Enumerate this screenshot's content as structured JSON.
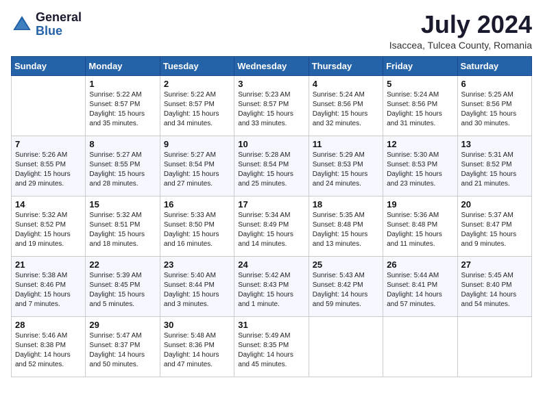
{
  "header": {
    "logo_general": "General",
    "logo_blue": "Blue",
    "month_title": "July 2024",
    "location": "Isaccea, Tulcea County, Romania"
  },
  "calendar": {
    "days_of_week": [
      "Sunday",
      "Monday",
      "Tuesday",
      "Wednesday",
      "Thursday",
      "Friday",
      "Saturday"
    ],
    "weeks": [
      [
        {
          "day": "",
          "info": ""
        },
        {
          "day": "1",
          "info": "Sunrise: 5:22 AM\nSunset: 8:57 PM\nDaylight: 15 hours\nand 35 minutes."
        },
        {
          "day": "2",
          "info": "Sunrise: 5:22 AM\nSunset: 8:57 PM\nDaylight: 15 hours\nand 34 minutes."
        },
        {
          "day": "3",
          "info": "Sunrise: 5:23 AM\nSunset: 8:57 PM\nDaylight: 15 hours\nand 33 minutes."
        },
        {
          "day": "4",
          "info": "Sunrise: 5:24 AM\nSunset: 8:56 PM\nDaylight: 15 hours\nand 32 minutes."
        },
        {
          "day": "5",
          "info": "Sunrise: 5:24 AM\nSunset: 8:56 PM\nDaylight: 15 hours\nand 31 minutes."
        },
        {
          "day": "6",
          "info": "Sunrise: 5:25 AM\nSunset: 8:56 PM\nDaylight: 15 hours\nand 30 minutes."
        }
      ],
      [
        {
          "day": "7",
          "info": "Sunrise: 5:26 AM\nSunset: 8:55 PM\nDaylight: 15 hours\nand 29 minutes."
        },
        {
          "day": "8",
          "info": "Sunrise: 5:27 AM\nSunset: 8:55 PM\nDaylight: 15 hours\nand 28 minutes."
        },
        {
          "day": "9",
          "info": "Sunrise: 5:27 AM\nSunset: 8:54 PM\nDaylight: 15 hours\nand 27 minutes."
        },
        {
          "day": "10",
          "info": "Sunrise: 5:28 AM\nSunset: 8:54 PM\nDaylight: 15 hours\nand 25 minutes."
        },
        {
          "day": "11",
          "info": "Sunrise: 5:29 AM\nSunset: 8:53 PM\nDaylight: 15 hours\nand 24 minutes."
        },
        {
          "day": "12",
          "info": "Sunrise: 5:30 AM\nSunset: 8:53 PM\nDaylight: 15 hours\nand 23 minutes."
        },
        {
          "day": "13",
          "info": "Sunrise: 5:31 AM\nSunset: 8:52 PM\nDaylight: 15 hours\nand 21 minutes."
        }
      ],
      [
        {
          "day": "14",
          "info": "Sunrise: 5:32 AM\nSunset: 8:52 PM\nDaylight: 15 hours\nand 19 minutes."
        },
        {
          "day": "15",
          "info": "Sunrise: 5:32 AM\nSunset: 8:51 PM\nDaylight: 15 hours\nand 18 minutes."
        },
        {
          "day": "16",
          "info": "Sunrise: 5:33 AM\nSunset: 8:50 PM\nDaylight: 15 hours\nand 16 minutes."
        },
        {
          "day": "17",
          "info": "Sunrise: 5:34 AM\nSunset: 8:49 PM\nDaylight: 15 hours\nand 14 minutes."
        },
        {
          "day": "18",
          "info": "Sunrise: 5:35 AM\nSunset: 8:48 PM\nDaylight: 15 hours\nand 13 minutes."
        },
        {
          "day": "19",
          "info": "Sunrise: 5:36 AM\nSunset: 8:48 PM\nDaylight: 15 hours\nand 11 minutes."
        },
        {
          "day": "20",
          "info": "Sunrise: 5:37 AM\nSunset: 8:47 PM\nDaylight: 15 hours\nand 9 minutes."
        }
      ],
      [
        {
          "day": "21",
          "info": "Sunrise: 5:38 AM\nSunset: 8:46 PM\nDaylight: 15 hours\nand 7 minutes."
        },
        {
          "day": "22",
          "info": "Sunrise: 5:39 AM\nSunset: 8:45 PM\nDaylight: 15 hours\nand 5 minutes."
        },
        {
          "day": "23",
          "info": "Sunrise: 5:40 AM\nSunset: 8:44 PM\nDaylight: 15 hours\nand 3 minutes."
        },
        {
          "day": "24",
          "info": "Sunrise: 5:42 AM\nSunset: 8:43 PM\nDaylight: 15 hours\nand 1 minute."
        },
        {
          "day": "25",
          "info": "Sunrise: 5:43 AM\nSunset: 8:42 PM\nDaylight: 14 hours\nand 59 minutes."
        },
        {
          "day": "26",
          "info": "Sunrise: 5:44 AM\nSunset: 8:41 PM\nDaylight: 14 hours\nand 57 minutes."
        },
        {
          "day": "27",
          "info": "Sunrise: 5:45 AM\nSunset: 8:40 PM\nDaylight: 14 hours\nand 54 minutes."
        }
      ],
      [
        {
          "day": "28",
          "info": "Sunrise: 5:46 AM\nSunset: 8:38 PM\nDaylight: 14 hours\nand 52 minutes."
        },
        {
          "day": "29",
          "info": "Sunrise: 5:47 AM\nSunset: 8:37 PM\nDaylight: 14 hours\nand 50 minutes."
        },
        {
          "day": "30",
          "info": "Sunrise: 5:48 AM\nSunset: 8:36 PM\nDaylight: 14 hours\nand 47 minutes."
        },
        {
          "day": "31",
          "info": "Sunrise: 5:49 AM\nSunset: 8:35 PM\nDaylight: 14 hours\nand 45 minutes."
        },
        {
          "day": "",
          "info": ""
        },
        {
          "day": "",
          "info": ""
        },
        {
          "day": "",
          "info": ""
        }
      ]
    ]
  }
}
